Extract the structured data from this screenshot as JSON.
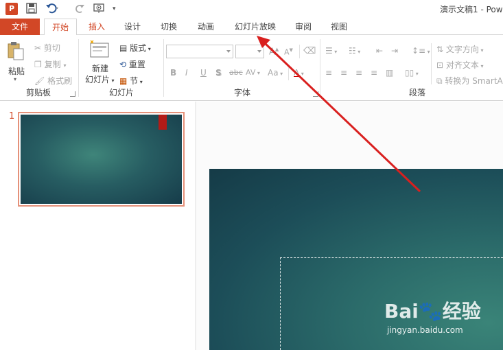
{
  "window": {
    "title": "演示文稿1 - Pow"
  },
  "quick_access": {
    "app_icon": "P",
    "icons": [
      "save-icon",
      "undo-icon",
      "redo-icon",
      "start-from-beginning-icon",
      "customize-icon"
    ]
  },
  "tabs": {
    "file": "文件",
    "items": [
      "开始",
      "插入",
      "设计",
      "切换",
      "动画",
      "幻灯片放映",
      "审阅",
      "视图"
    ],
    "active": "开始"
  },
  "ribbon": {
    "clipboard": {
      "label": "剪贴板",
      "paste": "粘贴",
      "cut": "剪切",
      "copy": "复制",
      "format_painter": "格式刷"
    },
    "slides": {
      "label": "幻灯片",
      "new_slide_line1": "新建",
      "new_slide_line2": "幻灯片",
      "layout": "版式",
      "reset": "重置",
      "section": "节"
    },
    "font": {
      "label": "字体",
      "bold": "B",
      "italic": "I",
      "underline": "U",
      "shadow": "S",
      "strikethrough": "abc",
      "spacing": "AV",
      "case": "Aa",
      "grow": "A",
      "shrink": "A"
    },
    "paragraph": {
      "label": "段落",
      "text_direction": "文字方向",
      "align_text": "对齐文本",
      "smartart": "转换为 SmartA"
    }
  },
  "thumbnails": {
    "slide_number": "1"
  },
  "watermark": {
    "brand": "Bai",
    "brand_suffix": "经验",
    "url": "jingyan.baidu.com"
  },
  "colors": {
    "accent": "#d24726",
    "annotation_arrow": "#d9201f"
  }
}
